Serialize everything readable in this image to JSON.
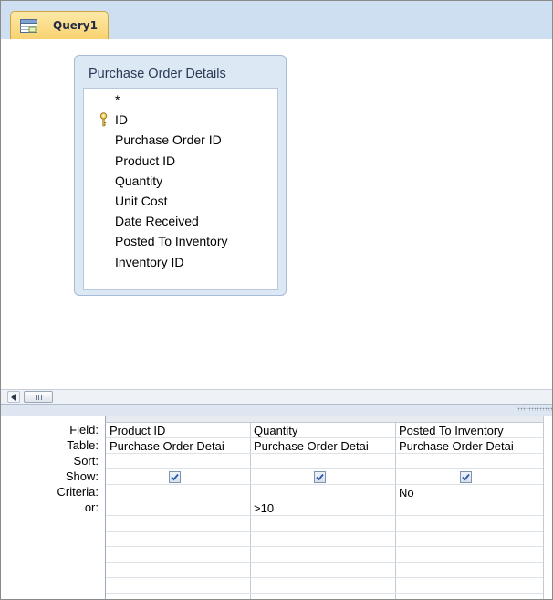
{
  "tab": {
    "title": "Query1",
    "icon": "query-design-icon"
  },
  "table": {
    "title": "Purchase Order Details",
    "fields": [
      {
        "name": "*",
        "key": false
      },
      {
        "name": "ID",
        "key": true
      },
      {
        "name": "Purchase Order ID",
        "key": false
      },
      {
        "name": "Product ID",
        "key": false
      },
      {
        "name": "Quantity",
        "key": false
      },
      {
        "name": "Unit Cost",
        "key": false
      },
      {
        "name": "Date Received",
        "key": false
      },
      {
        "name": "Posted To Inventory",
        "key": false
      },
      {
        "name": "Inventory ID",
        "key": false
      }
    ]
  },
  "grid": {
    "row_labels": [
      "Field:",
      "Table:",
      "Sort:",
      "Show:",
      "Criteria:",
      "or:"
    ],
    "columns": [
      {
        "field": "Product ID",
        "table": "Purchase Order Detai",
        "sort": "",
        "show": true,
        "criteria": "",
        "or": ""
      },
      {
        "field": "Quantity",
        "table": "Purchase Order Detai",
        "sort": "",
        "show": true,
        "criteria": "",
        "or": ">10"
      },
      {
        "field": "Posted To Inventory",
        "table": "Purchase Order Detai",
        "sort": "",
        "show": true,
        "criteria": "No",
        "or": ""
      }
    ]
  },
  "colors": {
    "tab_active": "#f8d270",
    "tab_strip": "#cfdff2",
    "table_box": "#dde8f5",
    "check": "#2b5aa8"
  }
}
